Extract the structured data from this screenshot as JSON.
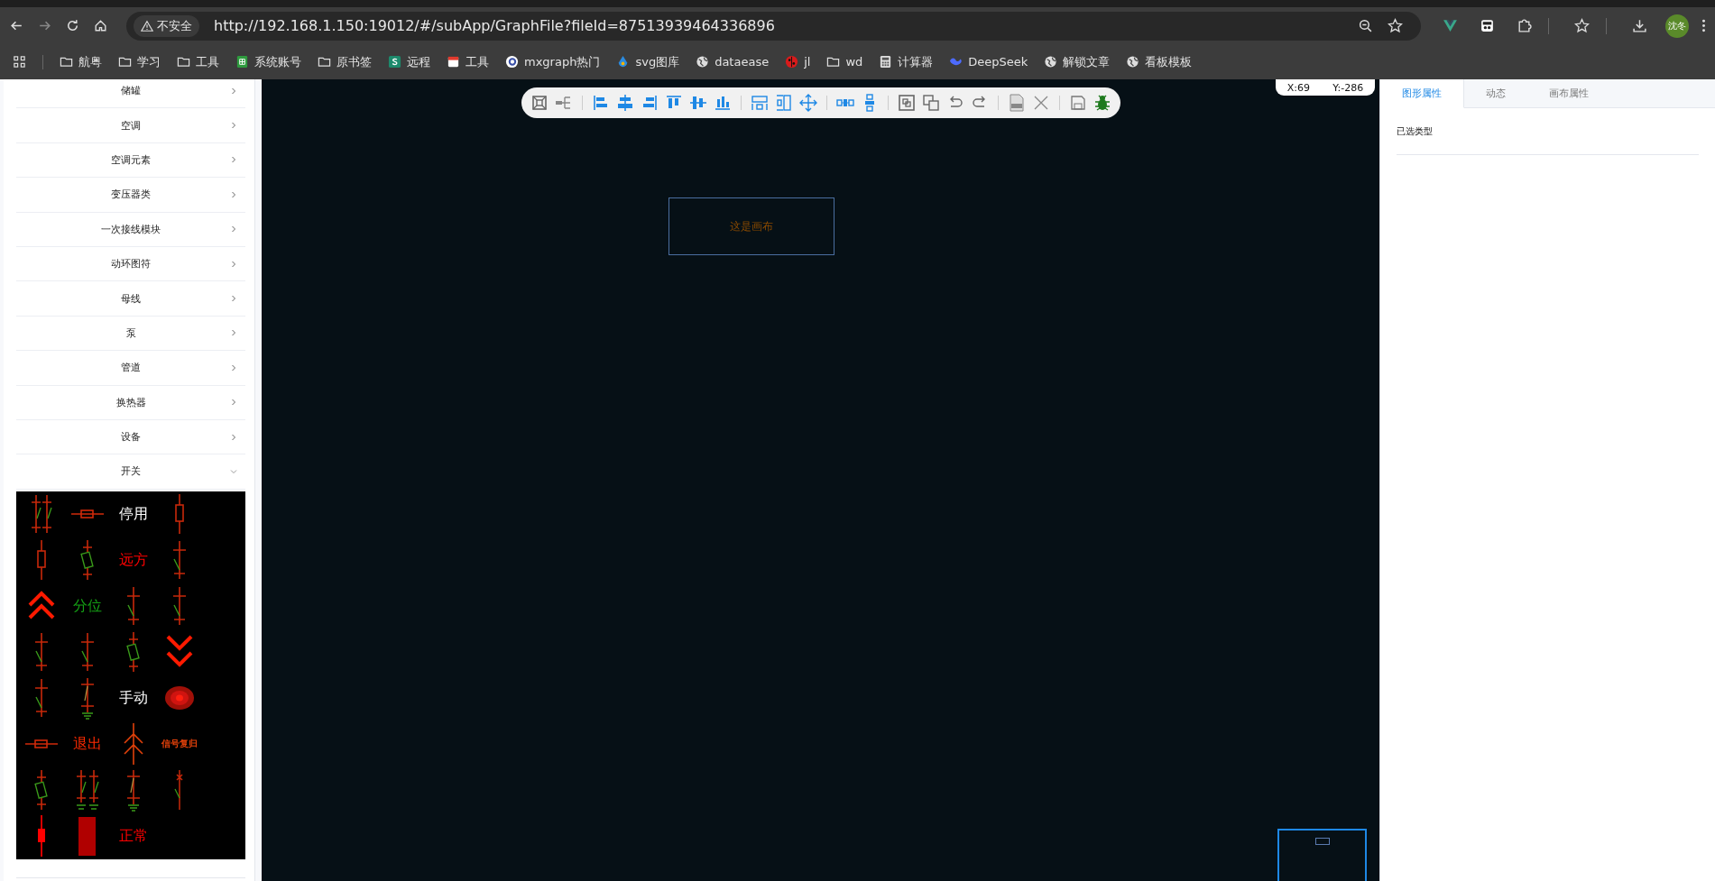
{
  "browser": {
    "security": "不安全",
    "url": "http://192.168.1.150:19012/#/subApp/GraphFile?fileId=87513939464336896",
    "profile": "沈冬"
  },
  "bookmarks": [
    {
      "label": "航粤",
      "kind": "folder"
    },
    {
      "label": "学习",
      "kind": "folder"
    },
    {
      "label": "工具",
      "kind": "folder"
    },
    {
      "label": "系统账号",
      "kind": "sheet"
    },
    {
      "label": "原书签",
      "kind": "folder"
    },
    {
      "label": "远程",
      "kind": "tile"
    },
    {
      "label": "工具",
      "kind": "calendar"
    },
    {
      "label": "mxgraph热门",
      "kind": "ring"
    },
    {
      "label": "svg图库",
      "kind": "drop"
    },
    {
      "label": "dataease",
      "kind": "globe"
    },
    {
      "label": "jl",
      "kind": "ladybug"
    },
    {
      "label": "wd",
      "kind": "folder"
    },
    {
      "label": "计算器",
      "kind": "calc"
    },
    {
      "label": "DeepSeek",
      "kind": "whale"
    },
    {
      "label": "解锁文章",
      "kind": "globe"
    },
    {
      "label": "看板模板",
      "kind": "globe"
    }
  ],
  "sidebar": {
    "items": [
      {
        "label": "储罐",
        "expanded": false
      },
      {
        "label": "空调",
        "expanded": false
      },
      {
        "label": "空调元素",
        "expanded": false
      },
      {
        "label": "变压器类",
        "expanded": false
      },
      {
        "label": "一次接线模块",
        "expanded": false
      },
      {
        "label": "动环图符",
        "expanded": false
      },
      {
        "label": "母线",
        "expanded": false
      },
      {
        "label": "泵",
        "expanded": false
      },
      {
        "label": "管道",
        "expanded": false
      },
      {
        "label": "换热器",
        "expanded": false
      },
      {
        "label": "设备",
        "expanded": false
      },
      {
        "label": "开关",
        "expanded": true
      }
    ]
  },
  "palette": {
    "items": [
      {
        "kind": "double-switch"
      },
      {
        "kind": "fuse"
      },
      {
        "kind": "text",
        "text": "停用",
        "color": "#ffffff"
      },
      {
        "kind": "breaker"
      },
      {
        "kind": "breaker"
      },
      {
        "kind": "green-breaker"
      },
      {
        "kind": "text",
        "text": "远方",
        "color": "#ff0000"
      },
      {
        "kind": "knife"
      },
      {
        "kind": "chevrons-up"
      },
      {
        "kind": "text",
        "text": "分位",
        "color": "#14a014"
      },
      {
        "kind": "knife"
      },
      {
        "kind": "knife"
      },
      {
        "kind": "knife"
      },
      {
        "kind": "knife"
      },
      {
        "kind": "green-breaker"
      },
      {
        "kind": "chevrons-down"
      },
      {
        "kind": "knife"
      },
      {
        "kind": "grounded"
      },
      {
        "kind": "text",
        "text": "手动",
        "color": "#ffffff"
      },
      {
        "kind": "lamp"
      },
      {
        "kind": "fuse"
      },
      {
        "kind": "text",
        "text": "退出",
        "color": "#ff2a00"
      },
      {
        "kind": "split"
      },
      {
        "kind": "small-text",
        "text": "信号复归",
        "color": "#e0400a"
      },
      {
        "kind": "green-breaker"
      },
      {
        "kind": "double-grounded"
      },
      {
        "kind": "grounded"
      },
      {
        "kind": "cross"
      },
      {
        "kind": "filled-breaker"
      },
      {
        "kind": "block"
      },
      {
        "kind": "text",
        "text": "正常",
        "color": "#ff0000"
      }
    ]
  },
  "canvas": {
    "coordinates": {
      "x": "X:69",
      "y": "Y:-286"
    },
    "label": "这是画布"
  },
  "panel": {
    "tabs": [
      {
        "label": "图形属性",
        "selected": true
      },
      {
        "label": "动态",
        "selected": false
      },
      {
        "label": "画布属性",
        "selected": false
      }
    ],
    "field_label": "已选类型"
  }
}
